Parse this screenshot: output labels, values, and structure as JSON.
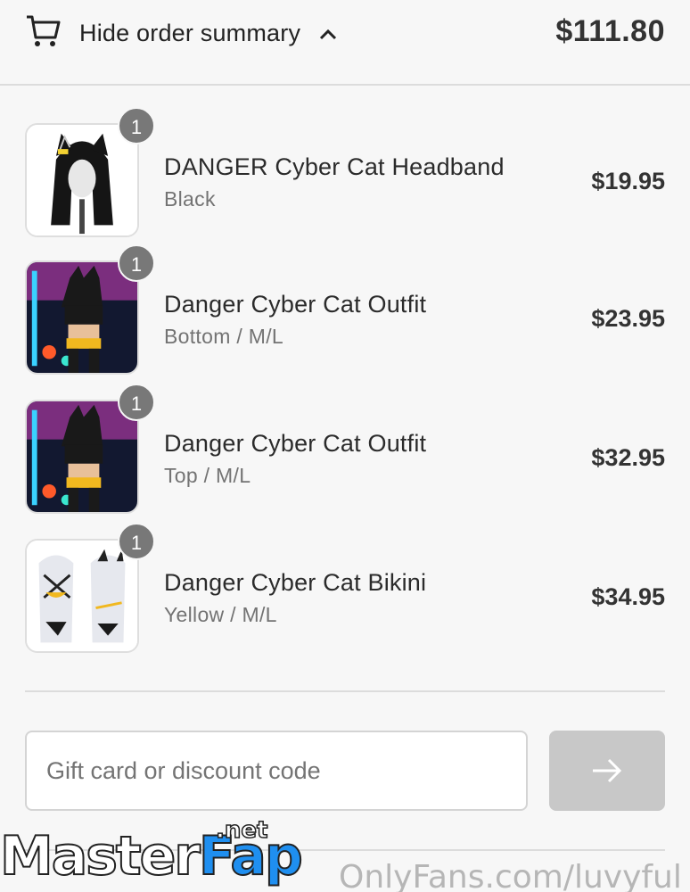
{
  "header": {
    "toggle_label": "Hide order summary",
    "total": "$111.80",
    "cart_icon": "cart-icon",
    "chevron_icon": "chevron-up-icon"
  },
  "items": [
    {
      "quantity": "1",
      "name": "DANGER Cyber Cat Headband",
      "variant": "Black",
      "price": "$19.95"
    },
    {
      "quantity": "1",
      "name": "Danger Cyber Cat Outfit",
      "variant": "Bottom / M/L",
      "price": "$23.95"
    },
    {
      "quantity": "1",
      "name": "Danger Cyber Cat Outfit",
      "variant": "Top / M/L",
      "price": "$32.95"
    },
    {
      "quantity": "1",
      "name": "Danger Cyber Cat Bikini",
      "variant": "Yellow / M/L",
      "price": "$34.95"
    }
  ],
  "discount": {
    "placeholder": "Gift card or discount code",
    "apply_icon": "arrow-right-icon"
  },
  "watermark": {
    "left_main": "Master",
    "left_accent": "Fap",
    "left_suffix": ".net",
    "right": "OnlyFans.com/luvyful"
  },
  "colors": {
    "badge": "#787878",
    "apply_button": "#c8c8c8",
    "background": "#f7f7f7"
  }
}
